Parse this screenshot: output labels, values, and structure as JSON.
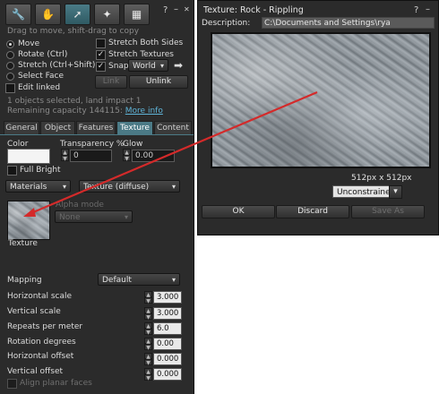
{
  "build": {
    "tools": [
      "wrench-icon",
      "hand-icon",
      "cursor-icon",
      "magic-wand-icon",
      "land-icon"
    ],
    "window_help": "?",
    "window_minimize": "–",
    "window_close": "✕",
    "hint": "Drag to move, shift-drag to copy",
    "modes": {
      "move": "Move",
      "rotate": "Rotate (Ctrl)",
      "stretch": "Stretch (Ctrl+Shift)",
      "select_face": "Select Face",
      "selected": "Move"
    },
    "options": {
      "stretch_both_sides": "Stretch Both Sides",
      "stretch_textures": "Stretch Textures",
      "snap": "Snap",
      "snap_value": "World",
      "edit_linked": "Edit linked"
    },
    "link_button": "Link",
    "unlink_button": "Unlink",
    "status_line1": "1 objects selected, land impact 1",
    "status_line2_prefix": "Remaining capacity 144115:",
    "status_line2_link": "More info",
    "tabs": [
      "General",
      "Object",
      "Features",
      "Texture",
      "Content"
    ],
    "active_tab": "Texture",
    "color_label": "Color",
    "transparency_label": "Transparency %",
    "transparency_value": "0",
    "glow_label": "Glow",
    "glow_value": "0.00",
    "full_bright_label": "Full Bright",
    "materials_dropdown": "Materials",
    "texture_dropdown": "Texture (diffuse)",
    "alpha_mode_label": "Alpha mode",
    "alpha_mode_value": "None",
    "texture_caption": "Texture",
    "mapping_label": "Mapping",
    "mapping_value": "Default",
    "rows": [
      {
        "label": "Horizontal scale",
        "value": "3.000"
      },
      {
        "label": "Vertical scale",
        "value": "3.000"
      },
      {
        "label": "Repeats per meter",
        "value": "6.0"
      },
      {
        "label": "Rotation degrees",
        "value": "0.00"
      },
      {
        "label": "Horizontal offset",
        "value": "0.000"
      },
      {
        "label": "Vertical offset",
        "value": "0.000"
      }
    ],
    "align_planar_label": "Align planar faces"
  },
  "picker": {
    "title": "Texture: Rock - Rippling",
    "help": "?",
    "minimize": "–",
    "description_label": "Description:",
    "description_value": "C:\\Documents and Settings\\rya",
    "dimensions": "512px x 512px",
    "aspect_dropdown": "Unconstrained",
    "ok_button": "OK",
    "discard_button": "Discard",
    "save_as_button": "Save As"
  },
  "colors": {
    "panel_bg": "#2b2b2b",
    "active_tab": "#4b7a86",
    "link_color": "#5fb4d8",
    "arrow_red": "#d42a2a"
  }
}
